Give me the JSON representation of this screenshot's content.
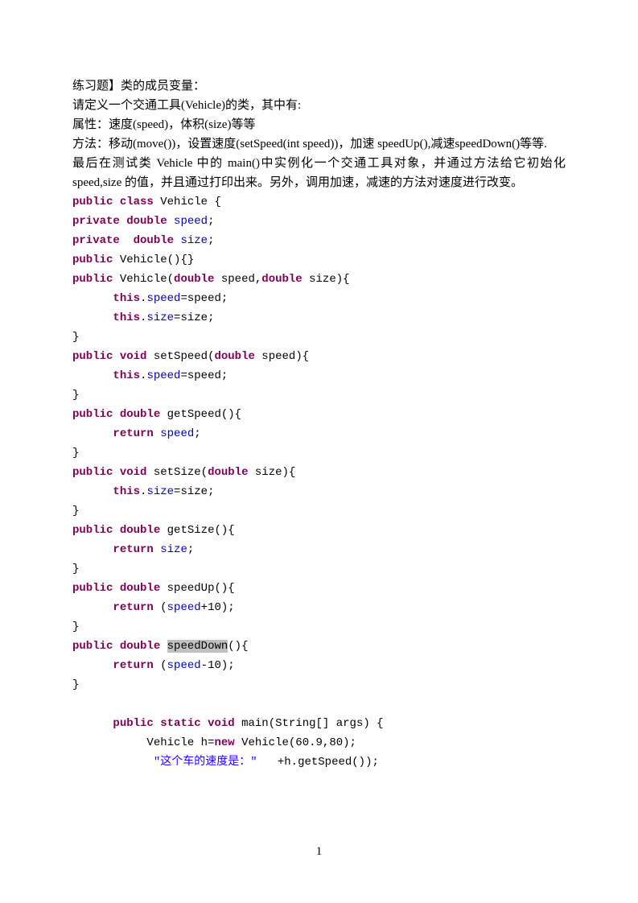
{
  "prose": {
    "p1": "练习题】类的成员变量：",
    "p2": "请定义一个交通工具(Vehicle)的类，其中有:",
    "p3": "属性：速度(speed)，体积(size)等等",
    "p4": "方法：移动(move())，设置速度(setSpeed(int speed))，加速 speedUp(),减速speedDown()等等.",
    "p5": "最后在测试类 Vehicle 中的 main()中实例化一个交通工具对象，并通过方法给它初始化 speed,size 的值，并且通过打印出来。另外，调用加速，减速的方法对速度进行改变。"
  },
  "code": {
    "kw_public": "public",
    "kw_class": "class",
    "kw_private": "private",
    "kw_double": "double",
    "kw_void": "void",
    "kw_this": "this",
    "kw_return": "return",
    "kw_static": "static",
    "kw_new": "new",
    "cls_Vehicle": "Vehicle",
    "field_speed": "speed",
    "field_size": "size",
    "m_setSpeed": "setSpeed",
    "m_getSpeed": "getSpeed",
    "m_setSize": "setSize",
    "m_getSize": "getSize",
    "m_speedUp": "speedUp",
    "m_speedDown": "speedDown",
    "m_main": "main",
    "arg_speed": "speed",
    "arg_size": "size",
    "arg_args": "args",
    "type_String": "String",
    "var_h": "h",
    "lit_609": "60.9",
    "lit_80": "80",
    "lit_plus10": "+10",
    "lit_minus10": "-10",
    "str_speedis": "\"这个车的速度是：\""
  },
  "pagenum": "1"
}
